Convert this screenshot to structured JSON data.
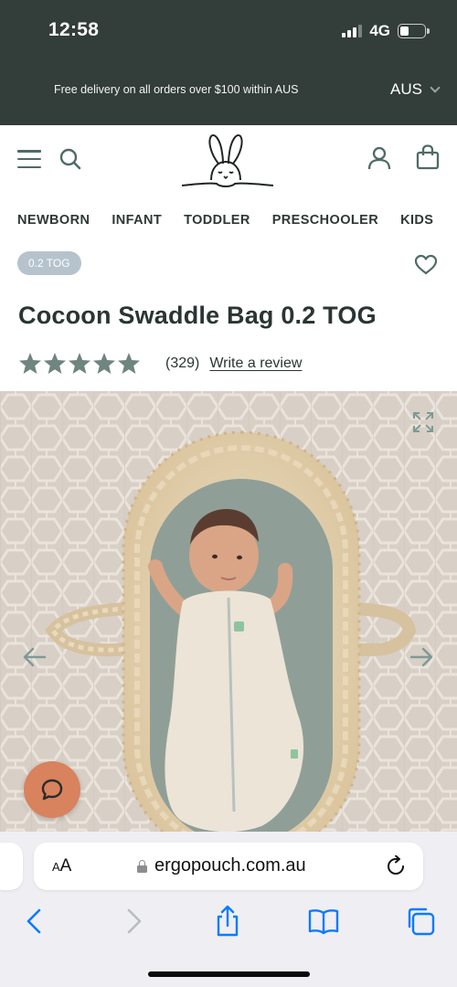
{
  "status": {
    "time": "12:58",
    "network": "4G"
  },
  "promo_bar": {
    "text": "Free delivery on all orders over $100 within AUS",
    "region": "AUS"
  },
  "header": {
    "logo": "bunny-logo"
  },
  "categories": [
    "NEWBORN",
    "INFANT",
    "TODDLER",
    "PRESCHOOLER",
    "KIDS"
  ],
  "product": {
    "badge": "0.2 TOG",
    "title": "Cocoon Swaddle Bag 0.2 TOG",
    "rating": 5,
    "review_count": "(329)",
    "review_link": "Write a review"
  },
  "browser": {
    "aa_small": "A",
    "aa_large": "A",
    "url": "ergopouch.com.au"
  },
  "colors": {
    "top_band": "#333d3a",
    "brand_teal": "#4e6b66",
    "stars": "#6e8580",
    "chat_button": "#d8825e",
    "badge": "#b6c3cd",
    "ios_blue": "#0a7aff"
  },
  "icons": [
    "hamburger-icon",
    "search-icon",
    "account-icon",
    "bag-icon",
    "heart-icon",
    "expand-icon",
    "arrow-left-icon",
    "arrow-right-icon",
    "chat-icon",
    "reload-icon",
    "back-icon",
    "forward-icon",
    "share-icon",
    "bookmarks-icon",
    "tabs-icon"
  ]
}
